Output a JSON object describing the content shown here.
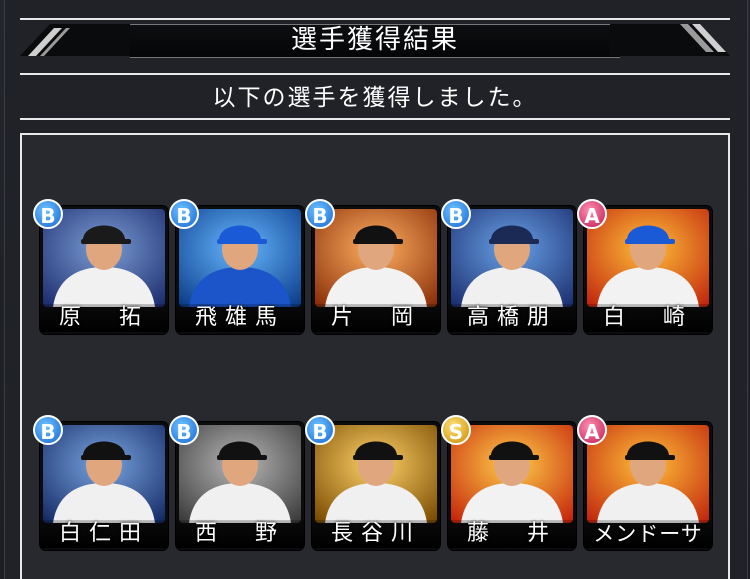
{
  "header": {
    "title": "選手獲得結果"
  },
  "message": "以下の選手を獲得しました。",
  "players": [
    {
      "name": "原　拓",
      "rank": "B",
      "bg1": "#7c9fd6",
      "bg2": "#1c2c6e",
      "uniform": "#f1f1f1",
      "cap": "#1a1a1a"
    },
    {
      "name": "飛雄馬",
      "rank": "B",
      "bg1": "#67b8ff",
      "bg2": "#0b3c8a",
      "uniform": "#1c55c9",
      "cap": "#1b5ad6"
    },
    {
      "name": "片　岡",
      "rank": "B",
      "bg1": "#ffb062",
      "bg2": "#8a2e08",
      "uniform": "#f2f2f2",
      "cap": "#111111"
    },
    {
      "name": "高橋朋",
      "rank": "B",
      "bg1": "#6aa2e8",
      "bg2": "#1b2f70",
      "uniform": "#f0f0f0",
      "cap": "#1a2a55"
    },
    {
      "name": "白　崎",
      "rank": "A",
      "bg1": "#ffbf3a",
      "bg2": "#c1260c",
      "uniform": "#f2f2f2",
      "cap": "#1b5ad6"
    },
    {
      "name": "白仁田",
      "rank": "B",
      "bg1": "#7aa6e0",
      "bg2": "#142a66",
      "uniform": "#f0f0f0",
      "cap": "#111111"
    },
    {
      "name": "西　野",
      "rank": "B",
      "bg1": "#b8b8b8",
      "bg2": "#3a3a3a",
      "uniform": "#f0f0f0",
      "cap": "#111111"
    },
    {
      "name": "長谷川",
      "rank": "B",
      "bg1": "#ffd36a",
      "bg2": "#7a4a00",
      "uniform": "#f0f0f0",
      "cap": "#111111"
    },
    {
      "name": "藤　井",
      "rank": "S",
      "bg1": "#ffcf4a",
      "bg2": "#c5240a",
      "uniform": "#f2f2f2",
      "cap": "#111111"
    },
    {
      "name": "メンドーサ",
      "rank": "A",
      "bg1": "#ffbf3a",
      "bg2": "#c1260c",
      "uniform": "#f0f0f0",
      "cap": "#111111"
    }
  ]
}
